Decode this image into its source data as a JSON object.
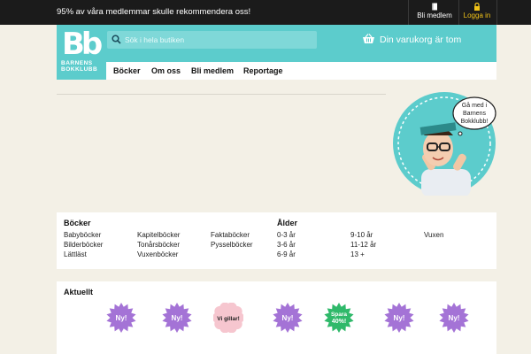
{
  "topbar": {
    "message": "95% av våra medlemmar skulle rekommendera oss!",
    "member_label": "Bli medlem",
    "login_label": "Logga in"
  },
  "header": {
    "logo_mark": "Bb",
    "logo_line1": "BARNENS",
    "logo_line2": "BOKKLUBB",
    "search_placeholder": "Sök i hela butiken",
    "cart_text": "Din varukorg är tom"
  },
  "nav": {
    "items": [
      "Böcker",
      "Om oss",
      "Bli medlem",
      "Reportage"
    ]
  },
  "promo": {
    "bubble_line1": "Gå med i",
    "bubble_line2": "Barnens",
    "bubble_line3": "Bokklubb!"
  },
  "categories": {
    "books_heading": "Böcker",
    "books_col1": [
      "Babyböcker",
      "Bilderböcker",
      "Lättläst"
    ],
    "books_col2": [
      "Kapitelböcker",
      "Tonårsböcker",
      "Vuxenböcker"
    ],
    "books_col3": [
      "Faktaböcker",
      "Pysselböcker"
    ],
    "age_heading": "Ålder",
    "age_col1": [
      "0-3 år",
      "3-6 år",
      "6-9 år"
    ],
    "age_col2": [
      "9-10 år",
      "11-12 år",
      "13 +"
    ],
    "age_col3": [
      "Vuxen"
    ]
  },
  "news": {
    "heading": "Aktuellt",
    "badges": [
      {
        "line1": "Ny!",
        "line2": "",
        "color": "#a473d6",
        "text_color": "#ffffff"
      },
      {
        "line1": "Ny!",
        "line2": "",
        "color": "#a473d6",
        "text_color": "#ffffff"
      },
      {
        "line1": "Vi gillar!",
        "line2": "",
        "color": "#f6c6cf",
        "text_color": "#222222"
      },
      {
        "line1": "Ny!",
        "line2": "",
        "color": "#a473d6",
        "text_color": "#ffffff"
      },
      {
        "line1": "Spara",
        "line2": "40%!",
        "color": "#2fb96a",
        "text_color": "#ffffff"
      },
      {
        "line1": "Ny!",
        "line2": "",
        "color": "#a473d6",
        "text_color": "#ffffff"
      },
      {
        "line1": "Ny!",
        "line2": "",
        "color": "#a473d6",
        "text_color": "#ffffff"
      }
    ]
  },
  "colors": {
    "brand_teal": "#5ccccc",
    "top_bar": "#1b1b1b",
    "login_yellow": "#f2c318",
    "page_bg": "#f3f0e6"
  }
}
